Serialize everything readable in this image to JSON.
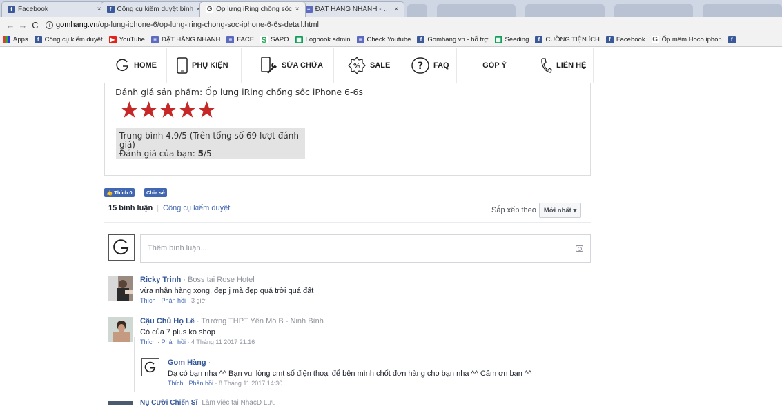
{
  "tabs": [
    {
      "title": "Facebook",
      "icon": "facebook-icon",
      "active": false
    },
    {
      "title": "Công cụ kiểm duyệt bình",
      "icon": "facebook-icon",
      "active": false
    },
    {
      "title": "Ốp lưng iRing chống sốc",
      "icon": "google-icon",
      "active": true
    },
    {
      "title": "ĐẶT HÀNG NHANH - GO",
      "icon": "docs-icon",
      "active": false
    }
  ],
  "tab_close": "×",
  "address": {
    "domain": "gomhang.vn",
    "path": "/op-lung-iphone-6/op-lung-iring-chong-soc-iphone-6-6s-detail.html"
  },
  "bookmarks": [
    {
      "label": "Apps",
      "icon": "apps-icon"
    },
    {
      "label": "Công cụ kiểm duyệt",
      "icon": "facebook-icon"
    },
    {
      "label": "YouTube",
      "icon": "youtube-icon"
    },
    {
      "label": "ĐẶT HÀNG NHANH",
      "icon": "docs-icon"
    },
    {
      "label": "FACE",
      "icon": "docs-icon"
    },
    {
      "label": "SAPO",
      "icon": "sapo-icon"
    },
    {
      "label": "Logbook admin",
      "icon": "sheets-icon"
    },
    {
      "label": "Check Youtube",
      "icon": "docs-icon"
    },
    {
      "label": "Gomhang.vn - hỗ trợ",
      "icon": "facebook-icon"
    },
    {
      "label": "Seeding",
      "icon": "sheets-icon"
    },
    {
      "label": "CUỒNG TIỆN ÍCH",
      "icon": "facebook-icon"
    },
    {
      "label": "Facebook",
      "icon": "facebook-icon"
    },
    {
      "label": "Ốp mềm Hoco iphon",
      "icon": "google-icon"
    }
  ],
  "site_nav": [
    {
      "label": "HOME",
      "icon": "gomhang-logo-icon"
    },
    {
      "label": "PHỤ KIỆN",
      "icon": "phone-icon"
    },
    {
      "label": "SỬA CHỮA",
      "icon": "wrench-phone-icon"
    },
    {
      "label": "SALE",
      "icon": "percent-badge-icon"
    },
    {
      "label": "FAQ",
      "icon": "question-icon"
    },
    {
      "label": "GÓP Ý",
      "icon": ""
    },
    {
      "label": "LIÊN HỆ",
      "icon": "phone-call-icon"
    }
  ],
  "rating": {
    "title": "Đánh giá sản phẩm: Ốp lưng iRing chống sốc iPhone 6-6s",
    "stars": 5,
    "star_color": "#c62828",
    "summary": "Trung bình 4.9/5 (Trên tổng số 69 lượt đánh giá)",
    "your_prefix": "Đánh giá của bạn: ",
    "your_value": "5",
    "your_suffix": "/5"
  },
  "social": {
    "like": "Thích 0",
    "share": "Chia sẻ"
  },
  "comments_header": {
    "count": "15 bình luận",
    "moderation": "Công cụ kiểm duyệt",
    "sort_label": "Sắp xếp theo",
    "sort_value": "Mới nhất ▾"
  },
  "comment_input": {
    "placeholder": "Thêm bình luận..."
  },
  "comments": [
    {
      "name": "Ricky Trinh",
      "meta": " · Boss tại Rose Hotel",
      "text": "vừa nhận hàng xong, đẹp j mà đẹp quá trời quá đất",
      "like": "Thích",
      "reply": "Phản hồi",
      "time": "3 giờ"
    },
    {
      "name": "Cậu Chủ Họ Lê",
      "meta": " · Trường THPT Yên Mô B - Ninh Bình",
      "text": "Có của 7 plus ko shop",
      "like": "Thích",
      "reply": "Phản hồi",
      "time": "4 Tháng 11 2017 21:16"
    }
  ],
  "reply": {
    "name": "Gom Hàng",
    "meta": " ·",
    "text": "Dạ có bạn nha ^^ Bạn vui lòng cmt số điện thoại để bên mình chốt đơn hàng cho bạn nha ^^ Cảm ơn bạn ^^",
    "like": "Thích",
    "reply": "Phản hồi",
    "time": "8 Tháng 11 2017 14:30"
  },
  "partial_comment": {
    "name": "Nụ Cười Chiến Sĩ",
    "meta": " · Làm việc tại NhacD Lưu"
  }
}
